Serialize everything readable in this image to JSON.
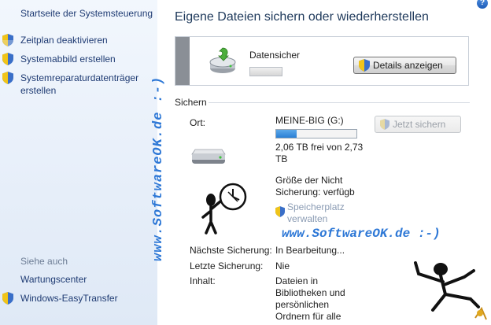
{
  "nav": {
    "top_link": "Startseite der Systemsteuerung",
    "tasks": [
      "Zeitplan deaktivieren",
      "Systemabbild erstellen",
      "Systemreparaturdatenträger",
      "erstellen"
    ],
    "see_also": "Siehe auch",
    "see_also_links": [
      "Wartungscenter",
      "Windows-EasyTransfer"
    ]
  },
  "watermark": {
    "vertical": "www.SoftwareOK.de :-)",
    "horizontal": "www.SoftwareOK.de :-)"
  },
  "main": {
    "title": "Eigene Dateien sichern oder wiederherstellen",
    "help": "?",
    "backup_status": {
      "label": "Datensicher",
      "progress": 0.0
    },
    "details_button": "Details anzeigen",
    "section": "Sichern",
    "backup_now_button": "Jetzt sichern",
    "location_label": "Ort:",
    "location_value": "MEINE-BIG (G:)",
    "drive_used_fraction": 0.25,
    "free_space_line1": "2,06 TB frei von 2,73",
    "free_space_line2": "TB",
    "backup_size_line1": "Größe der  Nicht",
    "backup_size_line2": "Sicherung: verfügb",
    "manage_space_line1": "Speicherplatz",
    "manage_space_line2": "verwalten",
    "next_backup_label": "Nächste Sicherung:",
    "next_backup_value": "In Bearbeitung...",
    "last_backup_label": "Letzte Sicherung:",
    "last_backup_value": "Nie",
    "content_label": "Inhalt:",
    "content_lines": [
      "Dateien in",
      "Bibliotheken und",
      "persönlichen",
      "Ordnern für alle"
    ]
  },
  "colors": {
    "nav_link": "#1f3b73",
    "title": "#1e395b",
    "watermark": "#2e78d6"
  }
}
